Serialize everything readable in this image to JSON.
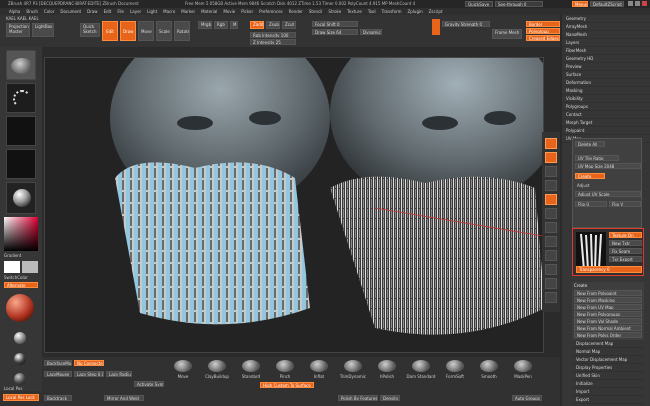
{
  "window": {
    "title": "ZBrush 4R7 P3 [DECQUEPDRANC-BIRAT-EDITE] ZBrush Document",
    "path": "Free Mem 5.058GB  Active Mem 9846  Scratch Disk 4012  ZTime 1.53  Timer 0.002  PolyCount 4.915 MP  MeshCount 4",
    "quicksave": "QuickSave",
    "see_through": "See-through 0",
    "menus_button": "Menus",
    "default_script": "DefaultZScript"
  },
  "menubar": [
    "Alpha",
    "Brush",
    "Color",
    "Document",
    "Draw",
    "Edit",
    "File",
    "Layer",
    "Light",
    "Macro",
    "Marker",
    "Material",
    "Movie",
    "Picker",
    "Preferences",
    "Render",
    "Stencil",
    "Stroke",
    "Texture",
    "Tool",
    "Transform",
    "Zplugin",
    "Zscript"
  ],
  "toolbar": {
    "doc_tab": "KAEL KAEL KAEL",
    "projection_master": "Projection Master",
    "lightbox": "LightBox",
    "quick_sketch": "Quick Sketch",
    "edit": "Edit",
    "draw": "Draw",
    "move": "Move",
    "scale": "Scale",
    "rotate": "Rotate",
    "mrgb": "Mrgb",
    "rgb": "Rgb",
    "m": "M",
    "zadd": "Zadd",
    "zsub": "Zsub",
    "zcut": "Zcut",
    "rgb_intensity": "Rgb Intensity 100",
    "z_intensity": "Z Intensity 25",
    "focal_shift": "Focal Shift 0",
    "draw_size": "Draw Size 64",
    "dynamic": "Dynamic",
    "active_points": "ActivePoints: 4.915 Mil",
    "total_points": "TotalPoints: 24.675 Mil",
    "gravity": "Gravity Strength 0",
    "frame_mesh": "Frame Mesh",
    "border": "Border",
    "polygroup": "Polygroup",
    "crease_edges": "Creased Edges"
  },
  "right_menu": [
    "Geometry",
    "ArrayMesh",
    "NanoMesh",
    "Layers",
    "FiberMesh",
    "Geometry HD",
    "Preview",
    "Surface",
    "Deformation",
    "Masking",
    "Visibility",
    "Polygroups",
    "Contact",
    "Morph Target",
    "Polypaint",
    "UV Map"
  ],
  "fibermesh_panel": {
    "header": "Delete All",
    "uv_tile": "UV Tile Ratio",
    "uv_size": "UV Map Size 2048",
    "uv_create": "Create",
    "adjust": "Adjust",
    "adjust_label": "Adjust UV Scale",
    "flip_u": "Flip U",
    "flip_v": "Flip V",
    "options": [
      "Texture On",
      "New Txtr",
      "Fix Seam",
      "Txr Export",
      "Transparency 0"
    ],
    "clone": "Clone Txtr",
    "texture_map": "Texture Map",
    "create_group": "Create",
    "create_items": [
      "New From Polypaint",
      "New From Masking",
      "New From UV Map",
      "New From Polygroups",
      "New From Vol Shade",
      "New From Normal Ambient",
      "New From Polys Order"
    ],
    "lower_items": [
      "Displacement Map",
      "Normal Map",
      "Vector Displacement Map",
      "Display Properties",
      "Unified Skin",
      "Initialize",
      "Import",
      "Export"
    ]
  },
  "left_shelf": {
    "gradient": "Gradient",
    "switch_color": "SwitchColor",
    "alternate": "Alternate",
    "local_pos": "Local Pos",
    "local_pos2": "Local Pos Lock"
  },
  "bottom_bar": {
    "backface": "BackfaceMask",
    "no_connected": "No Connected",
    "lazy_mouse": "LazyMouse",
    "lazy_step": "Lazy Step 0.05",
    "lazy_radius": "Lazy Radius 1",
    "brushes": [
      "Move",
      "ClayBuildup",
      "Standard",
      "Pinch",
      "Inflat",
      "TrimDynamic",
      "hPolish",
      "Dam Standard",
      "FormSoft",
      "Smooth",
      "MaskPen"
    ],
    "high_custom": "High Custom To Surface",
    "strokes": [
      "DragRect",
      "FreeHand",
      "Spray",
      "DragDot"
    ],
    "backtrack": "Backtrack",
    "mirror": "Mirror And Weld",
    "polish": "Polish By Features",
    "density": "Density",
    "auto_groups": "Auto Groups",
    "sym_label": "Activate Symmetry"
  },
  "colors": {
    "accent": "#e8641a",
    "accent_light": "#ff8b3d",
    "panel_bg": "#3a3a3a",
    "viewport_bg": "#2a2a2a"
  }
}
